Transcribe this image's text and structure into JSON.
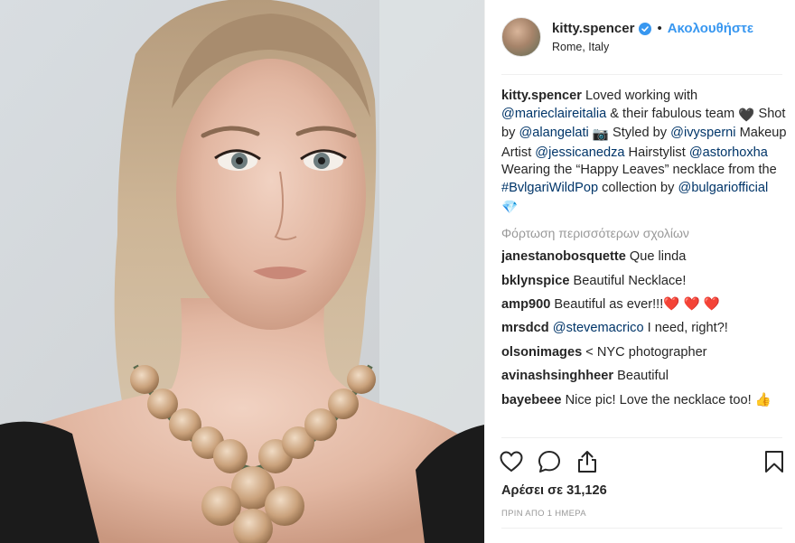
{
  "header": {
    "username": "kitty.spencer",
    "separator": "•",
    "follow_label": "Ακολουθήστε",
    "location": "Rome, Italy"
  },
  "caption": {
    "user": "kitty.spencer",
    "segments": [
      {
        "text": " Loved working with ",
        "type": "text"
      },
      {
        "text": "@marieclaireitalia",
        "type": "mention"
      },
      {
        "text": " & their fabulous team ",
        "type": "text"
      },
      {
        "text": "🖤",
        "type": "emoji"
      },
      {
        "text": " Shot by ",
        "type": "text"
      },
      {
        "text": "@alangelati",
        "type": "mention"
      },
      {
        "text": " ",
        "type": "text"
      },
      {
        "text": "📷",
        "type": "emoji"
      },
      {
        "text": " Styled by ",
        "type": "text"
      },
      {
        "text": "@ivysperni",
        "type": "mention"
      },
      {
        "text": " Makeup Artist ",
        "type": "text"
      },
      {
        "text": "@jessicanedza",
        "type": "mention"
      },
      {
        "text": " Hairstylist ",
        "type": "text"
      },
      {
        "text": "@astorhoxha",
        "type": "mention"
      },
      {
        "text": " Wearing the “Happy Leaves” necklace from the ",
        "type": "text"
      },
      {
        "text": "#BvlgariWildPop",
        "type": "mention"
      },
      {
        "text": " collection by ",
        "type": "text"
      },
      {
        "text": "@bulgariofficial",
        "type": "mention"
      },
      {
        "text": " ",
        "type": "text"
      },
      {
        "text": "💎",
        "type": "emoji"
      }
    ]
  },
  "load_more_label": "Φόρτωση περισσότερων σχολίων",
  "comments": [
    {
      "user": "janestanobosquette",
      "text": " Que linda",
      "mention": ""
    },
    {
      "user": "bklynspice",
      "text": " Beautiful Necklace!",
      "mention": ""
    },
    {
      "user": "amp900",
      "text": " Beautiful as ever!!!❤️ ❤️ ❤️",
      "mention": ""
    },
    {
      "user": "mrsdcd",
      "mention": " @stevemacrico",
      "text": " I need, right?!"
    },
    {
      "user": "olsonimages",
      "text": " < NYC photographer",
      "mention": ""
    },
    {
      "user": "avinashsinghheer",
      "text": " Beautiful",
      "mention": ""
    },
    {
      "user": "bayebeee",
      "text": " Nice pic! Love the necklace too! 👍",
      "mention": ""
    }
  ],
  "actions": {
    "like_icon": "heart-icon",
    "comment_icon": "comment-bubble-icon",
    "share_icon": "share-icon",
    "save_icon": "bookmark-icon"
  },
  "likes_label": "Αρέσει σε 31,126",
  "timestamp": "ΠΡΙΝ ΑΠΟ 1 ΗΜΕΡΑ",
  "colors": {
    "link": "#003569",
    "follow": "#3897f0",
    "muted": "#999999",
    "verified": "#3897f0"
  }
}
